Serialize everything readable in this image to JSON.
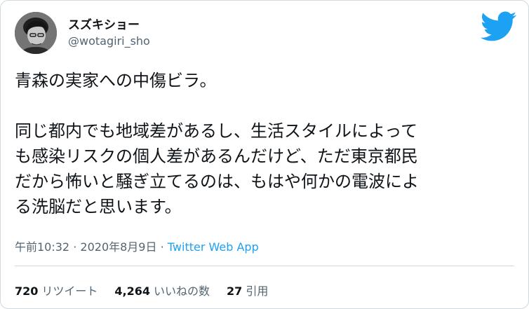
{
  "user": {
    "display_name": "スズキショー",
    "handle": "@wotagiri_sho",
    "avatar": "avatar-photo-icon"
  },
  "brand": {
    "icon": "twitter-bird-icon",
    "color": "#1da1f2"
  },
  "tweet": {
    "text": "青森の実家への中傷ビラ。\n\n同じ都内でも地域差があるし、生活スタイルによって\nも感染リスクの個人差があるんだけど、ただ東京都民\nだから怖いと騒ぎ立てるのは、もはや何かの電波によ\nる洗脳だと思います。",
    "time": "午前10:32",
    "separator": "·",
    "date": "2020年8月9日",
    "source": "Twitter Web App"
  },
  "stats": {
    "retweets_count": "720",
    "retweets_label": "リツイート",
    "likes_count": "4,264",
    "likes_label": "いいねの数",
    "quotes_count": "27",
    "quotes_label": "引用"
  },
  "colors": {
    "text": "#0f1419",
    "secondary": "#536471",
    "link": "#1da1f2",
    "border": "#cfd9de"
  }
}
